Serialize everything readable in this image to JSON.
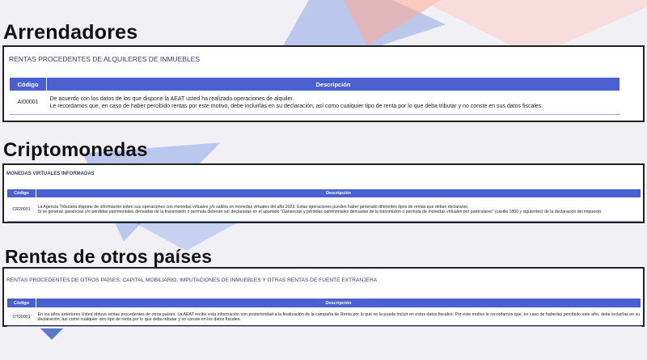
{
  "sections": [
    {
      "heading": "Arrendadores",
      "panel_title": "RENTAS PROCEDENTES DE ALQUILERES DE INMUEBLES",
      "col_code": "Código",
      "col_desc": "Descripción",
      "row_code": "AI00001",
      "row_desc": [
        "De acuerdo con los datos de los que dispone la AEAT usted ha realizado operaciones de alquiler.",
        "Le recordamos que, en caso de haber percibido rentas por este motivo, debe incluirlas en su declaración, así como cualquier tipo de renta por lo que deba tributar y no conste en sus datos fiscales."
      ]
    },
    {
      "heading": "Criptomonedas",
      "panel_title": "MONEDAS VIRTUALES INFORMADAS",
      "col_code": "Código",
      "col_desc": "Descripción",
      "row_code": "CR20001",
      "row_desc": [
        "La Agencia Tributaria dispone de información sobre sus operaciones con monedas virtuales y/o saldos en monedas virtuales del año 2023. Estas operaciones pueden haber generado diferentes tipos de rentas que deban declararse.",
        "Si se generan ganancias y/o pérdidas patrimoniales derivadas de la transmisión o permuta deberán ser declaradas en el apartado \"Ganancias y pérdidas patrimoniales derivadas de la transmisión o permuta de monedas virtuales por particulares\" (casilla 1800 y siguientes) de la declaración del impuesto."
      ]
    },
    {
      "heading": "Rentas de otros países",
      "panel_title": "RENTAS PROCEDENTES DE OTROS PAÍSES: CAPITAL MOBILIARIO, IMPUTACIONES DE INMUEBLES Y OTRAS RENTAS DE FUENTE EXTRANJERA",
      "col_code": "Código",
      "col_desc": "Descripción",
      "row_code": "OT00001",
      "row_desc": [
        "En los años anteriores Usted obtuvo rentas procedentes de otros países. La AEAT recibe esta información con posterioridad a la finalización de la campaña de Renta por lo que no la puede incluir en estos datos fiscales. Por este motivo le recordamos que, en caso de haberlas percibido este año, debe incluirlas en su declaración, así como cualquier otro tipo de renta por lo que deba tributar y no conste en los datos fiscales."
      ]
    }
  ],
  "colors": {
    "header_bg": "#4a5fd0",
    "title_text": "#3c3a6e",
    "accent_blue": "#5b79c9",
    "accent_peach": "#ffaa96"
  }
}
